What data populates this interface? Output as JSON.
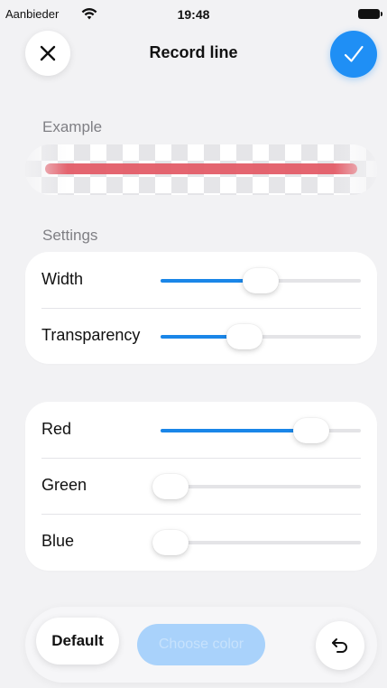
{
  "status_bar": {
    "carrier": "Aanbieder",
    "time": "19:48"
  },
  "nav": {
    "title": "Record line"
  },
  "example": {
    "label": "Example",
    "line_color": "#e35d68"
  },
  "settings": {
    "label": "Settings",
    "width": {
      "label": "Width",
      "value_pct": 50
    },
    "transparency": {
      "label": "Transparency",
      "value_pct": 42
    }
  },
  "color": {
    "red": {
      "label": "Red",
      "value_pct": 75
    },
    "green": {
      "label": "Green",
      "value_pct": 5
    },
    "blue": {
      "label": "Blue",
      "value_pct": 5
    }
  },
  "toolbar": {
    "default_label": "Default",
    "choose_color_label": "Choose color"
  },
  "colors": {
    "accent": "#1f8ff5",
    "slider_fill": "#1a86e8",
    "background": "#f2f2f4"
  }
}
